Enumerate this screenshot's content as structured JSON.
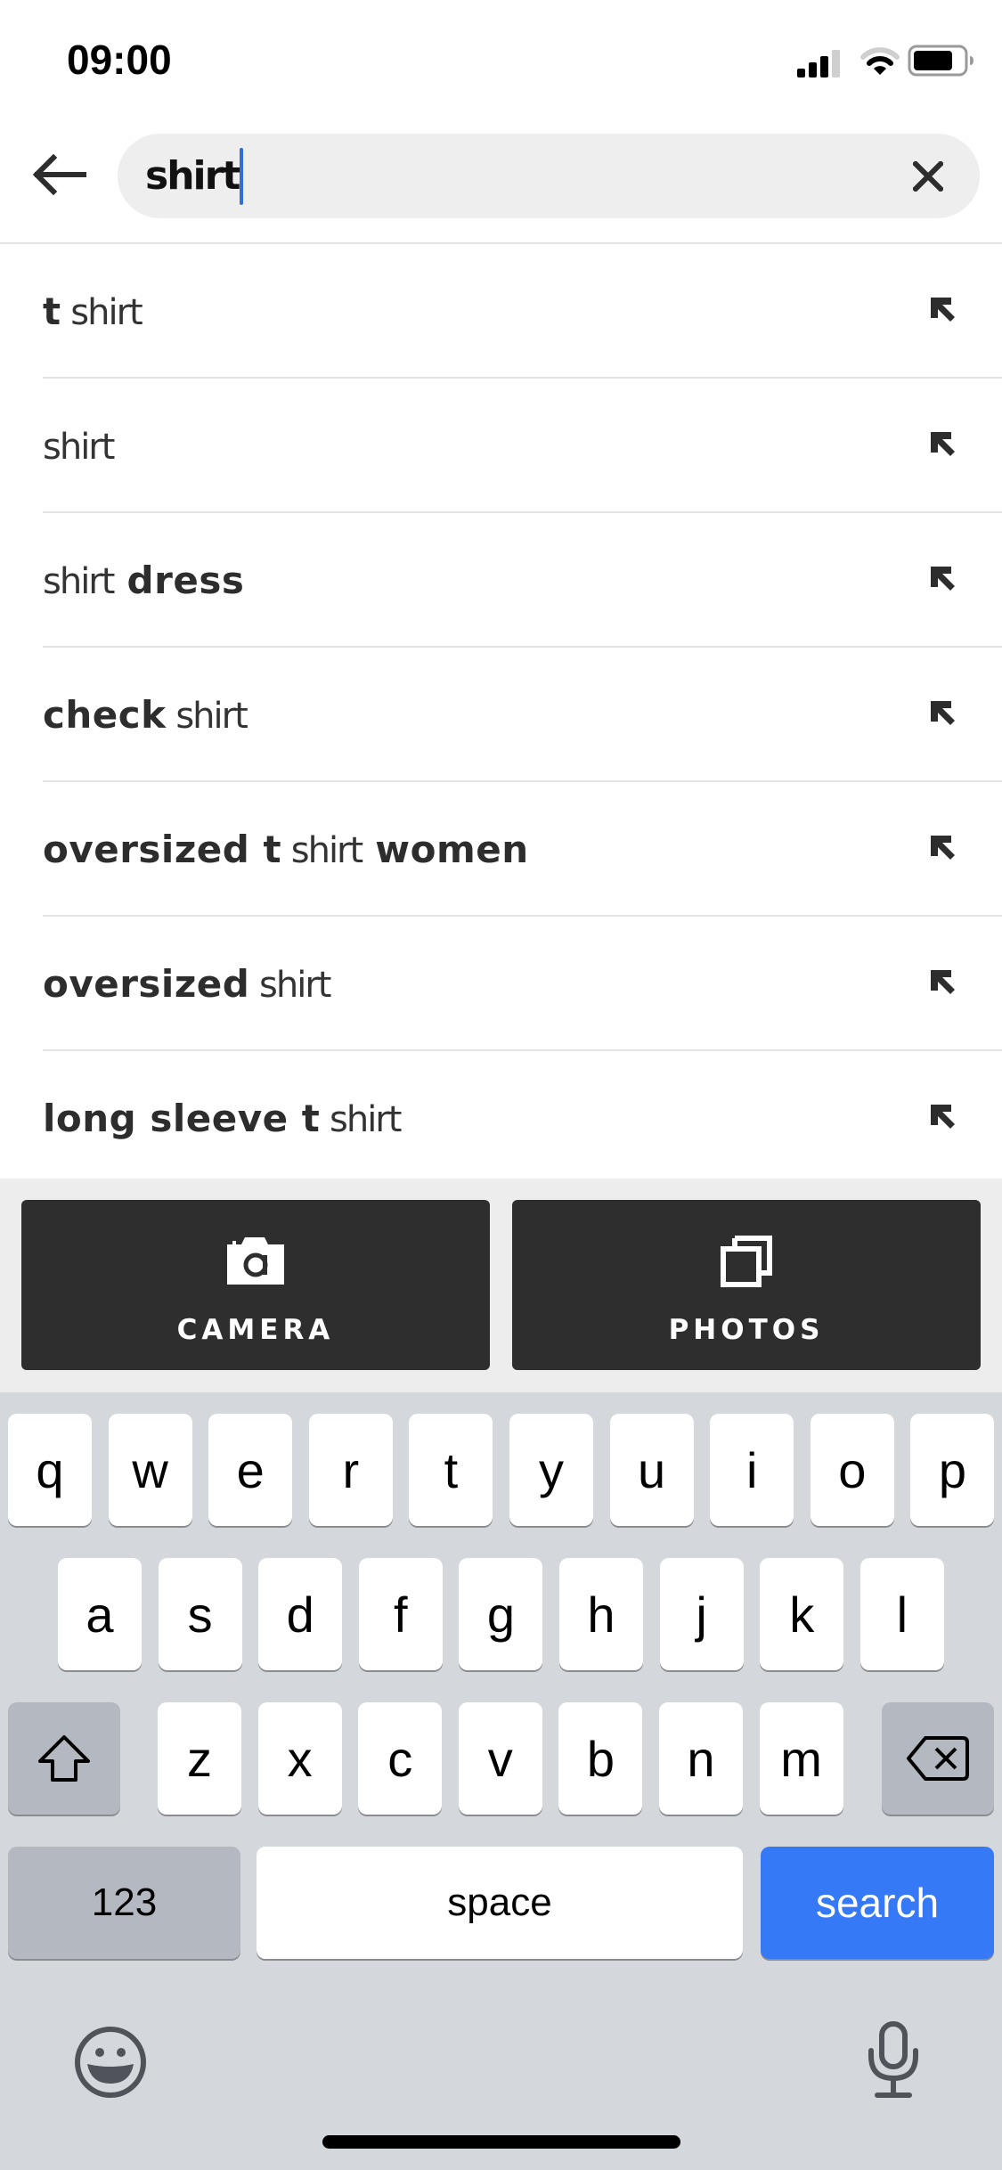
{
  "status_bar": {
    "time": "09:00",
    "signal_bars_filled": 3,
    "signal_bars_total": 4,
    "wifi_arcs_filled": 2,
    "wifi_arcs_total": 3,
    "battery_level": 0.8,
    "icons": [
      "signal-icon",
      "wifi-icon",
      "battery-icon"
    ]
  },
  "header": {
    "back_icon": "arrow-left-icon",
    "search": {
      "value": "shirt",
      "clear_icon": "close-icon"
    }
  },
  "suggestions": [
    {
      "parts": [
        {
          "text": "t",
          "bold": true
        },
        {
          "text": " shirt",
          "bold": false
        }
      ],
      "icon": "arrow-up-left-icon"
    },
    {
      "parts": [
        {
          "text": "shirt",
          "bold": false
        }
      ],
      "icon": "arrow-up-left-icon"
    },
    {
      "parts": [
        {
          "text": "shirt",
          "bold": false
        },
        {
          "text": " dress",
          "bold": true
        }
      ],
      "icon": "arrow-up-left-icon"
    },
    {
      "parts": [
        {
          "text": "check",
          "bold": true
        },
        {
          "text": " shirt",
          "bold": false
        }
      ],
      "icon": "arrow-up-left-icon"
    },
    {
      "parts": [
        {
          "text": "oversized t",
          "bold": true
        },
        {
          "text": " shirt",
          "bold": false
        },
        {
          "text": " women",
          "bold": true
        }
      ],
      "icon": "arrow-up-left-icon"
    },
    {
      "parts": [
        {
          "text": "oversized",
          "bold": true
        },
        {
          "text": " shirt",
          "bold": false
        }
      ],
      "icon": "arrow-up-left-icon"
    },
    {
      "parts": [
        {
          "text": "long sleeve t",
          "bold": true
        },
        {
          "text": " shirt",
          "bold": false
        }
      ],
      "icon": "arrow-up-left-icon"
    }
  ],
  "visual_search": {
    "camera": {
      "label": "CAMERA",
      "icon": "camera-icon"
    },
    "photos": {
      "label": "PHOTOS",
      "icon": "photos-icon"
    }
  },
  "keyboard": {
    "row1": [
      "q",
      "w",
      "e",
      "r",
      "t",
      "y",
      "u",
      "i",
      "o",
      "p"
    ],
    "row2": [
      "a",
      "s",
      "d",
      "f",
      "g",
      "h",
      "j",
      "k",
      "l"
    ],
    "row3": [
      "z",
      "x",
      "c",
      "v",
      "b",
      "n",
      "m"
    ],
    "shift_icon": "shift-icon",
    "delete_icon": "backspace-icon",
    "numbers_label": "123",
    "space_label": "space",
    "action_label": "search",
    "emoji_icon": "emoji-icon",
    "mic_icon": "microphone-icon"
  },
  "colors": {
    "accent_blue": "#3579f6",
    "caret": "#2f6fd6",
    "button_dark": "#2e2e2e",
    "keyboard_bg": "#d4d7dc"
  }
}
